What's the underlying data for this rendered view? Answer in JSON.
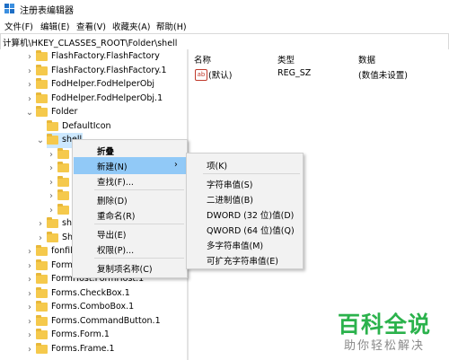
{
  "window": {
    "title": "注册表编辑器"
  },
  "menu": [
    "文件(F)",
    "编辑(E)",
    "查看(V)",
    "收藏夹(A)",
    "帮助(H)"
  ],
  "address": "计算机\\HKEY_CLASSES_ROOT\\Folder\\shell",
  "tree": {
    "items": [
      {
        "label": "FlashFactory.FlashFactory",
        "chevron": "›"
      },
      {
        "label": "FlashFactory.FlashFactory.1",
        "chevron": "›"
      },
      {
        "label": "FodHelper.FodHelperObj",
        "chevron": "›"
      },
      {
        "label": "FodHelper.FodHelperObj.1",
        "chevron": "›"
      },
      {
        "label": "Folder",
        "chevron": "⌄"
      },
      {
        "label": "DefaultIcon",
        "chevron": ""
      },
      {
        "label": "shell",
        "chevron": "⌄"
      },
      {
        "label": "",
        "chevron": "›"
      },
      {
        "label": "",
        "chevron": "›"
      },
      {
        "label": "",
        "chevron": "›"
      },
      {
        "label": "",
        "chevron": "›"
      },
      {
        "label": "",
        "chevron": "›"
      },
      {
        "label": "she",
        "chevron": "›"
      },
      {
        "label": "She",
        "chevron": "›"
      },
      {
        "label": "fonfile",
        "chevron": "›"
      },
      {
        "label": "FormH",
        "chevron": "›"
      },
      {
        "label": "FormHost.FormHost.1",
        "chevron": "›"
      },
      {
        "label": "Forms.CheckBox.1",
        "chevron": "›"
      },
      {
        "label": "Forms.ComboBox.1",
        "chevron": "›"
      },
      {
        "label": "Forms.CommandButton.1",
        "chevron": "›"
      },
      {
        "label": "Forms.Form.1",
        "chevron": "›"
      },
      {
        "label": "Forms.Frame.1",
        "chevron": "›"
      }
    ]
  },
  "values_panel": {
    "headers": {
      "name": "名称",
      "type": "类型",
      "data": "数据"
    },
    "rows": [
      {
        "name": "(默认)",
        "type": "REG_SZ",
        "data": "(数值未设置)",
        "icon": "ab"
      }
    ]
  },
  "context_menu": {
    "items": [
      {
        "label": "折叠"
      },
      {
        "label": "新建(N)",
        "arrow": "›"
      },
      {
        "label": "查找(F)..."
      },
      {
        "label": "删除(D)"
      },
      {
        "label": "重命名(R)"
      },
      {
        "label": "导出(E)"
      },
      {
        "label": "权限(P)..."
      },
      {
        "label": "复制项名称(C)"
      }
    ]
  },
  "submenu": {
    "items": [
      {
        "label": "项(K)"
      },
      {
        "label": "字符串值(S)"
      },
      {
        "label": "二进制值(B)"
      },
      {
        "label": "DWORD (32 位)值(D)"
      },
      {
        "label": "QWORD (64 位)值(Q)"
      },
      {
        "label": "多字符串值(M)"
      },
      {
        "label": "可扩充字符串值(E)"
      }
    ]
  },
  "watermark": {
    "brand": "百科全说",
    "tagline": "助你轻松解决"
  },
  "colors": {
    "folder": "#f5c94c",
    "selection": "#cce8ff",
    "menu_highlight": "#91c9f7",
    "watermark": "#2bb24c"
  }
}
